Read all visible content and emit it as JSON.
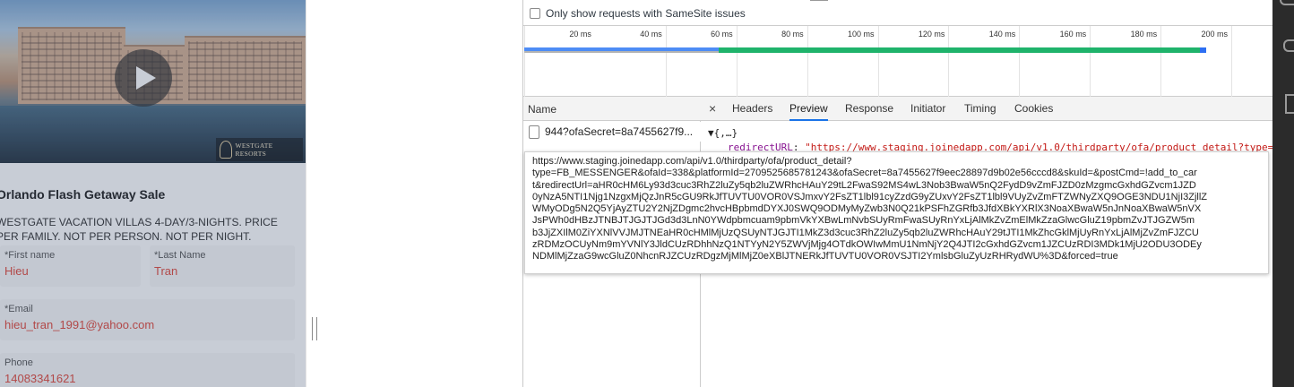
{
  "promo": {
    "title": "Orlando Flash Getaway Sale",
    "description": "WESTGATE VACATION VILLAS 4-DAY/3-NIGHTS. PRICE PER FAMILY. NOT PER PERSON. NOT PER NIGHT.",
    "logo_text": "WESTGATE RESORTS",
    "first_name_label": "*First name",
    "first_name_value": "Hieu",
    "last_name_label": "*Last Name",
    "last_name_value": "Tran",
    "email_label": "*Email",
    "email_value": "hieu_tran_1991@yahoo.com",
    "phone_label": "Phone",
    "phone_value": "14083341621"
  },
  "devtools": {
    "samesite_label": "Only show requests with SameSite issues",
    "timeline_ticks": [
      "20 ms",
      "40 ms",
      "60 ms",
      "80 ms",
      "100 ms",
      "120 ms",
      "140 ms",
      "160 ms",
      "180 ms",
      "200 ms"
    ],
    "name_header": "Name",
    "request_name": "944?ofaSecret=8a7455627f9...",
    "tabs": [
      "Headers",
      "Preview",
      "Response",
      "Initiator",
      "Timing",
      "Cookies"
    ],
    "active_tab": "Preview",
    "preview_root": "{,…}",
    "preview_key": "redirectURL",
    "preview_value": "\"https://www.staging.joinedapp.com/api/v1.0/thirdparty/ofa/product_detail?type=",
    "tooltip_lines": [
      "https://www.staging.joinedapp.com/api/v1.0/thirdparty/ofa/product_detail?",
      "type=FB_MESSENGER&ofaId=338&platformId=2709525685781243&ofaSecret=8a7455627f9eec28897d9b02e56cccd8&skuId=&postCmd=!add_to_car",
      "t&redirectUrl=aHR0cHM6Ly93d3cuc3RhZ2luZy5qb2luZWRhcHAuY29tL2FwaS92MS4wL3Nob3BwaW5nQ2FydD9vZmFJZD0zMzgmcGxhdGZvcm1JZD",
      "0yNzA5NTI1Njg1NzgxMjQzJnR5cGU9RkJfTUVTU0VOR0VSJmxvY2FsZT1lbl91cyZzdG9yZUxvY2FsZT1lbl9VUyZvZmFTZWNyZXQ9OGE3NDU1NjI3ZjllZ",
      "WMyODg5N2Q5YjAyZTU2Y2NjZDgmc2hvcHBpbmdDYXJ0SWQ9ODMyMyZwb3N0Q21kPSFhZGRfb3JfdXBkYXRlX3NoaXBwaW5nJnNoaXBwaW5nVX",
      "JsPWh0dHBzJTNBJTJGJTJGd3d3LnN0YWdpbmcuam9pbmVkYXBwLmNvbSUyRmFwaSUyRnYxLjAlMkZvZmElMkZzaGlwcGluZ19pbmZvJTJGZW5m",
      "b3JjZXIlM0ZiYXNlVVJMJTNEaHR0cHMlMjUzQSUyNTJGJTI1MkZ3d3cuc3RhZ2luZy5qb2luZWRhcHAuY29tJTI1MkZhcGklMjUyRnYxLjAlMjZvZmFJZCU",
      "zRDMzOCUyNm9mYVNlY3JldCUzRDhhNzQ1NTYyN2Y5ZWVjMjg4OTdkOWIwMmU1NmNjY2Q4JTI2cGxhdGZvcm1JZCUzRDI3MDk1MjU2ODU3ODEy",
      "NDMlMjZzaG9wcGluZ0NhcnRJZCUzRDgzMjMlMjZ0eXBlJTNERkJfTUVTU0VOR0VSJTI2YmlsbGluZyUzRHRydWU%3D&forced=true"
    ]
  }
}
